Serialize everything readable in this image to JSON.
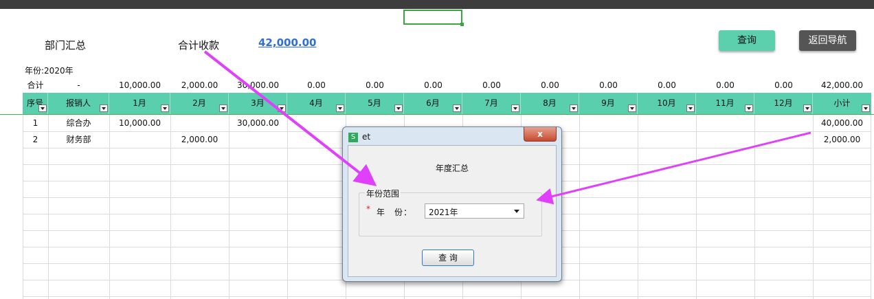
{
  "page": {
    "dept_summary_label": "部门汇总",
    "total_receipts_label": "合计收款",
    "total_receipts_value": "42,000.00",
    "query_button": "查询",
    "back_button": "返回导航",
    "year_label": "年份:2020年"
  },
  "sum_row": {
    "label": "合计",
    "reporter": "-",
    "values": [
      "10,000.00",
      "2,000.00",
      "30,000.00",
      "0.00",
      "0.00",
      "0.00",
      "0.00",
      "0.00",
      "0.00",
      "0.00",
      "0.00",
      "0.00",
      "42,000.00"
    ]
  },
  "table": {
    "headers": [
      "序号",
      "报销人",
      "1月",
      "2月",
      "3月",
      "4月",
      "5月",
      "6月",
      "7月",
      "8月",
      "9月",
      "10月",
      "11月",
      "12月",
      "小计"
    ],
    "rows": [
      {
        "no": "1",
        "name": "综合办",
        "jan": "10,000.00",
        "feb": "",
        "mar": "30,000.00",
        "subtotal": "40,000.00"
      },
      {
        "no": "2",
        "name": "财务部",
        "jan": "",
        "feb": "2,000.00",
        "mar": "",
        "subtotal": "2,000.00"
      }
    ]
  },
  "dialog": {
    "title": "et",
    "icon_letter": "S",
    "close_glyph": "x",
    "heading": "年度汇总",
    "group_label": "年份范围",
    "required_mark": "*",
    "year_field_label": "年　份：",
    "year_value": "2021年",
    "query_button": "查 询"
  },
  "colors": {
    "header_bg": "#59cfae",
    "query_button_bg": "#5ccfad",
    "back_button_bg": "#555555",
    "link": "#2f6fd4",
    "annotation_arrow": "#e040fb"
  }
}
